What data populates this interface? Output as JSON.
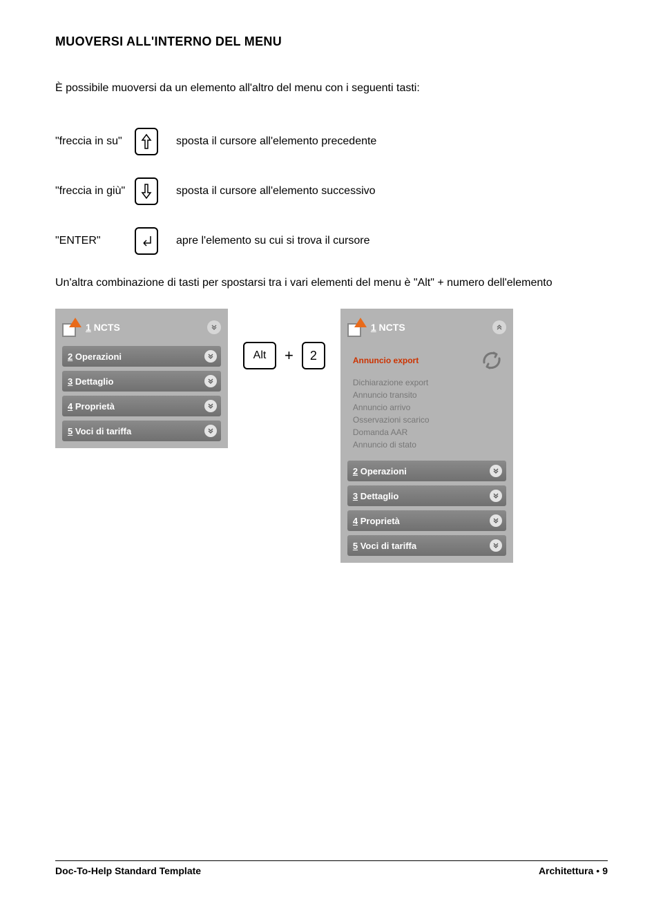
{
  "title": "MUOVERSI ALL'INTERNO DEL MENU",
  "intro": "È possibile muoversi da un elemento all'altro del menu con i seguenti tasti:",
  "keys": {
    "up": {
      "label": "\"freccia in su\"",
      "desc": "sposta il cursore all'elemento precedente"
    },
    "down": {
      "label": "\"freccia in giù\"",
      "desc": "sposta il cursore all'elemento successivo"
    },
    "enter": {
      "label": "\"ENTER\"",
      "desc": "apre l'elemento su cui si trova il cursore"
    }
  },
  "para2": "Un'altra combinazione di tasti per spostarsi tra i vari elementi del menu è \"Alt\" + numero dell'elemento",
  "combo": {
    "alt": "Alt",
    "plus": "+",
    "num": "2"
  },
  "menuA": {
    "header": "NCTS",
    "header_num": "1",
    "items": [
      {
        "num": "2",
        "label": "Operazioni"
      },
      {
        "num": "3",
        "label": "Dettaglio"
      },
      {
        "num": "4",
        "label": "Proprietà"
      },
      {
        "num": "5",
        "label": "Voci di tariffa"
      }
    ]
  },
  "menuB": {
    "header": "NCTS",
    "header_num": "1",
    "subitems": [
      {
        "label": "Annuncio export",
        "highlight": true
      },
      {
        "label": "Dichiarazione export"
      },
      {
        "label": "Annuncio transito"
      },
      {
        "label": "Annuncio arrivo"
      },
      {
        "label": "Osservazioni scarico"
      },
      {
        "label": "Domanda AAR"
      },
      {
        "label": "Annuncio di stato"
      }
    ],
    "items": [
      {
        "num": "2",
        "label": "Operazioni"
      },
      {
        "num": "3",
        "label": "Dettaglio"
      },
      {
        "num": "4",
        "label": "Proprietà"
      },
      {
        "num": "5",
        "label": "Voci di tariffa"
      }
    ]
  },
  "footer": {
    "left": "Doc-To-Help Standard Template",
    "right_section": "Architettura",
    "right_page": "9"
  }
}
